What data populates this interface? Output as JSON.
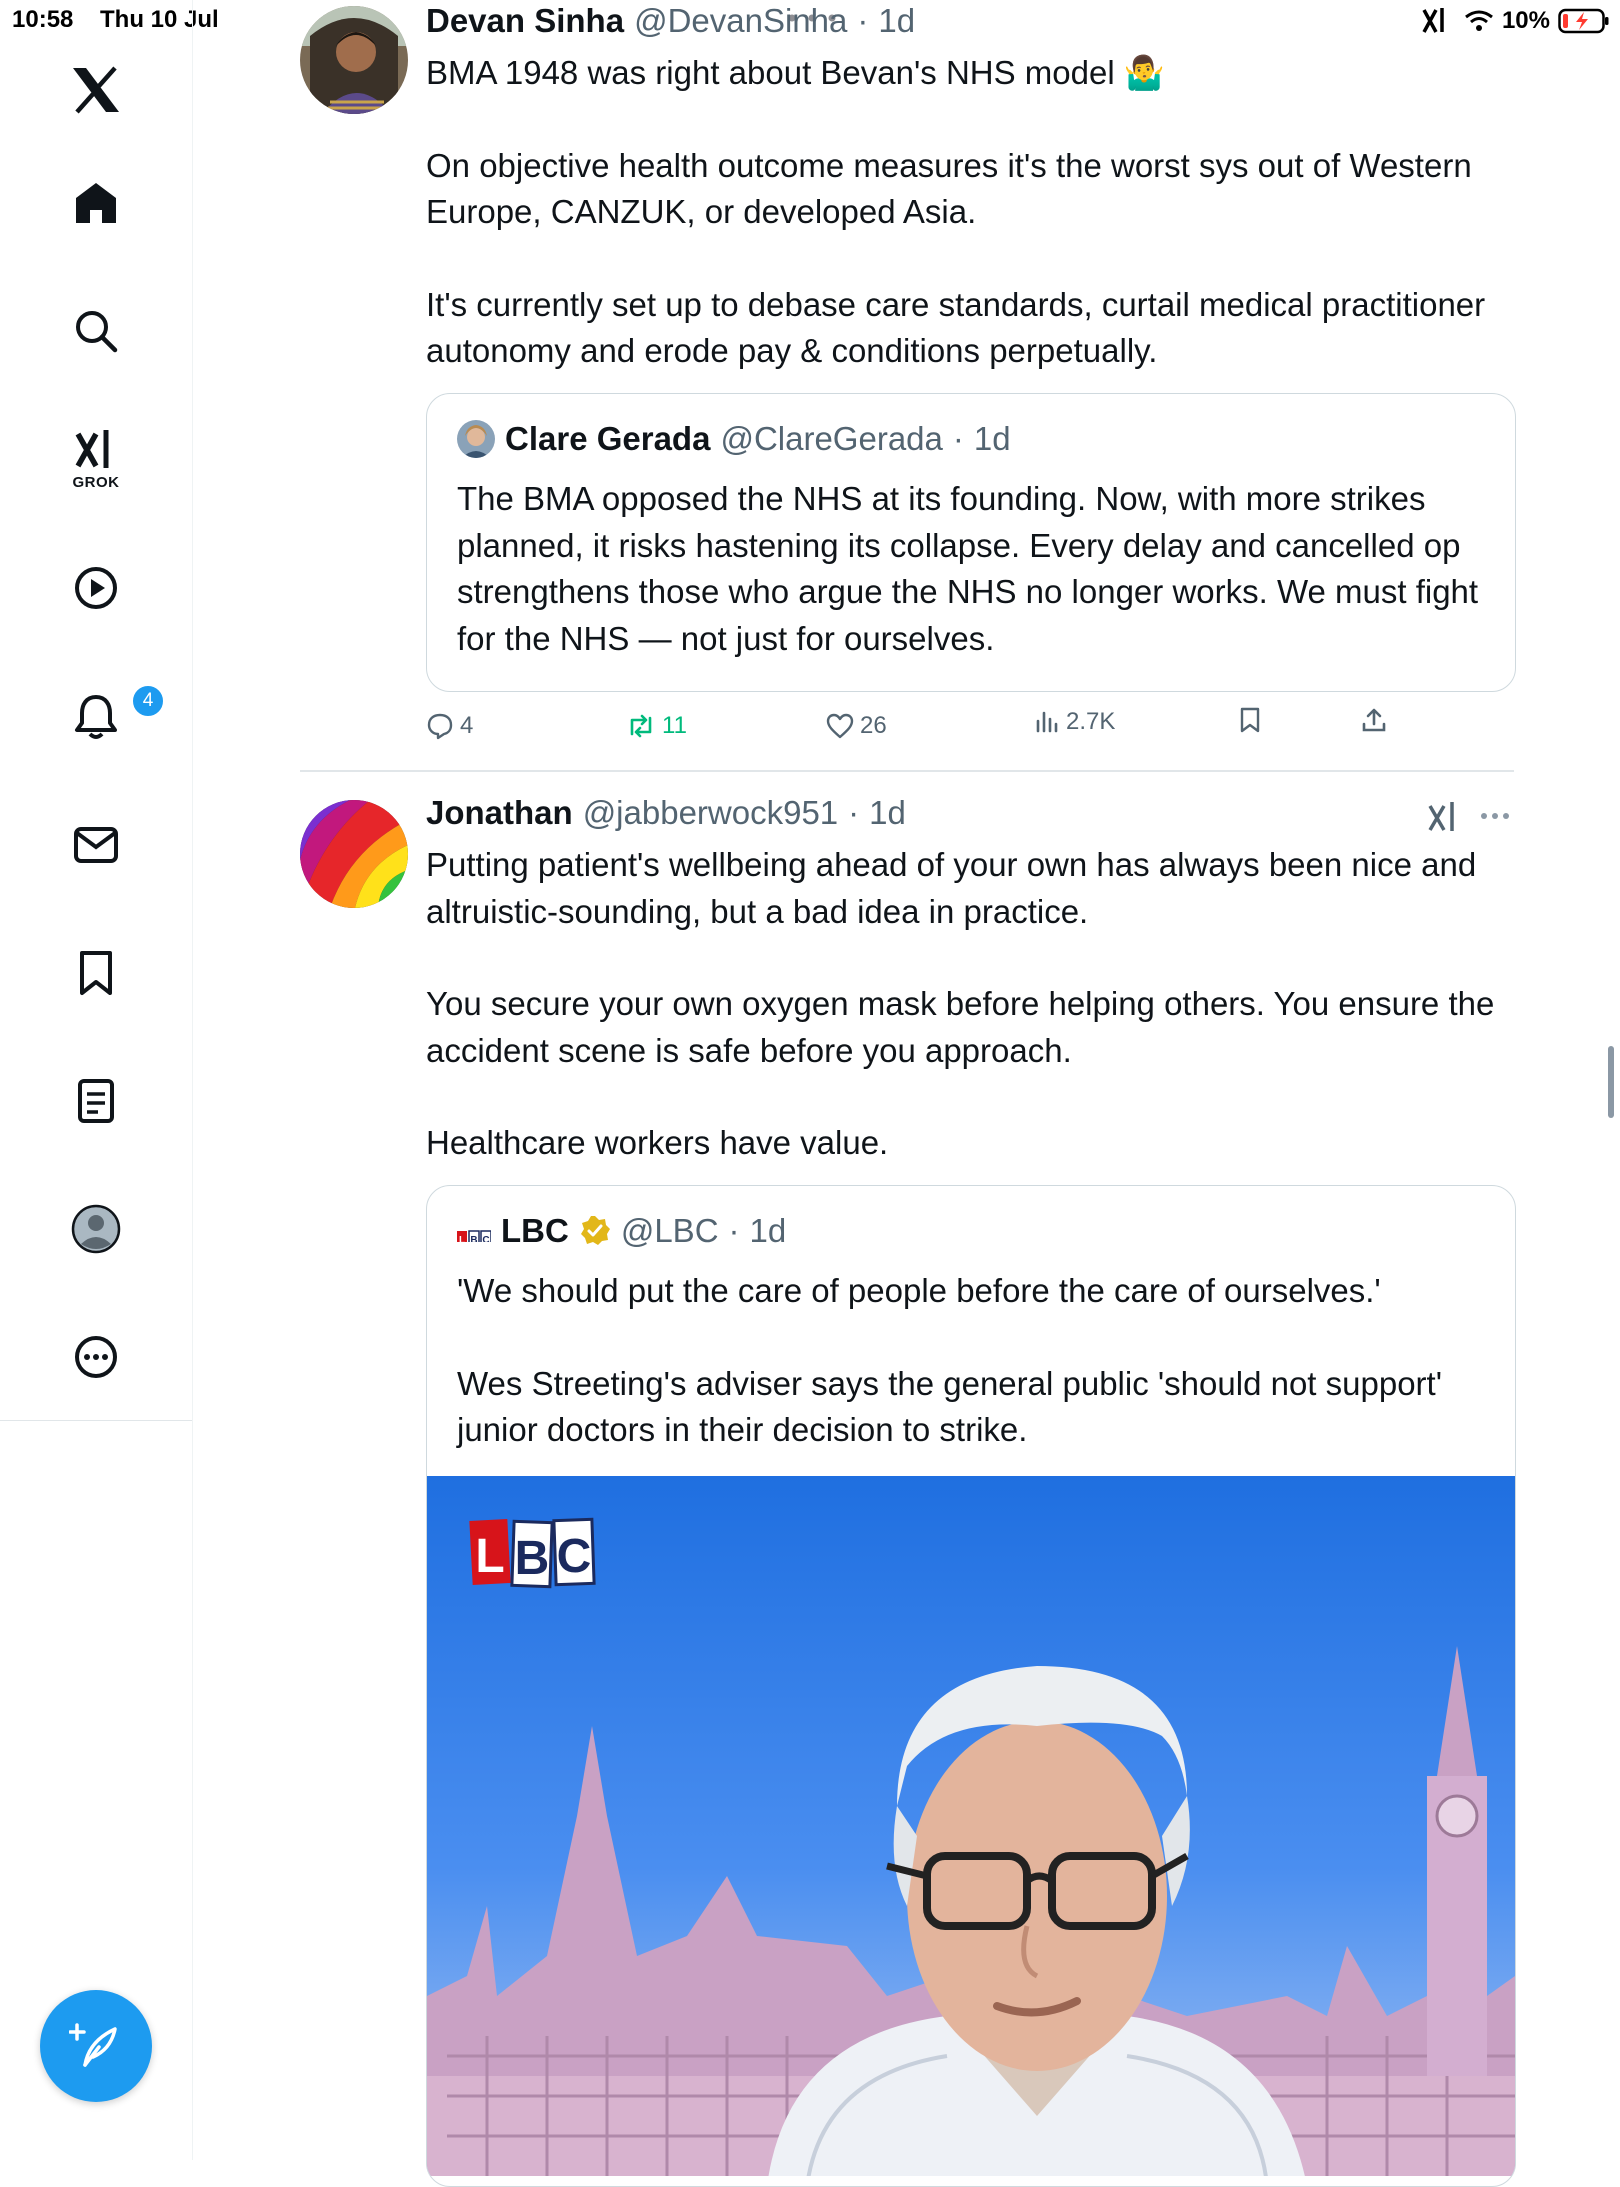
{
  "status_bar": {
    "time": "10:58",
    "date": "Thu 10 Jul",
    "battery": "10%"
  },
  "sidebar": {
    "items": [
      {
        "name": "x-logo-icon"
      },
      {
        "name": "home-icon"
      },
      {
        "name": "search-icon"
      },
      {
        "name": "grok-icon",
        "label": "GROK"
      },
      {
        "name": "video-icon"
      },
      {
        "name": "notifications-icon",
        "badge": "4"
      },
      {
        "name": "messages-icon"
      },
      {
        "name": "bookmarks-icon"
      },
      {
        "name": "lists-icon"
      },
      {
        "name": "profile-icon"
      },
      {
        "name": "more-icon"
      }
    ],
    "compose_icon": "compose-icon",
    "accent_color": "#1d9bf0"
  },
  "tweets": [
    {
      "name": "Devan Sinha",
      "handle": "@DevanSinha",
      "dot": "·",
      "time": "1d",
      "text_lines": [
        "BMA 1948 was right about Bevan's NHS model 🤷‍♂️",
        "On objective health outcome measures it's the worst sys out of Western Europe, CANZUK, or developed Asia.",
        "It's currently set up to debase care standards, curtail medical practitioner autonomy and erode pay & conditions perpetually."
      ],
      "quote": {
        "name": "Clare Gerada",
        "handle": "@ClareGerada",
        "dot": "·",
        "time": "1d",
        "text": "The BMA opposed the NHS at its founding. Now, with more strikes planned, it risks hastening its collapse. Every delay and cancelled op strengthens those who argue the NHS no longer works. We must fight for the NHS — not just for ourselves."
      },
      "actions": {
        "replies": "4",
        "reposts": "11",
        "likes": "26",
        "views": "2.7K"
      }
    },
    {
      "name": "Jonathan",
      "handle": "@jabberwock951",
      "dot": "·",
      "time": "1d",
      "text_lines": [
        "Putting patient's wellbeing ahead of your own has always been nice and altruistic-sounding, but a bad idea in practice.",
        "You secure your own oxygen mask before helping others. You ensure the accident scene is safe before you approach.",
        "Healthcare workers have value."
      ],
      "quote": {
        "name": "LBC",
        "handle": "@LBC",
        "dot": "·",
        "time": "1d",
        "verified": true,
        "text_lines": [
          "'We should put the care of people before the care of ourselves.'",
          "Wes Streeting's adviser says the general public 'should not support' junior doctors in their decision to strike."
        ],
        "media_logo_text": "LBC"
      }
    }
  ]
}
